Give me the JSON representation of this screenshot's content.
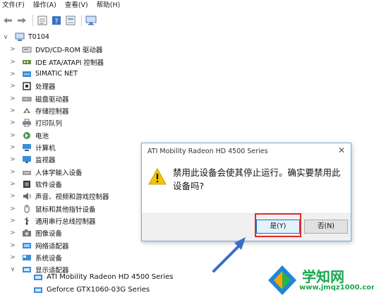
{
  "menu": [
    "文件(F)",
    "操作(A)",
    "查看(V)",
    "帮助(H)"
  ],
  "toolbar_icons": [
    "back-arrow-icon",
    "forward-arrow-icon",
    "properties-icon",
    "help-icon",
    "device-view-icon",
    "monitor-icon"
  ],
  "tree": {
    "root": "T0104",
    "categories": [
      {
        "label": "DVD/CD-ROM 驱动器",
        "icon": "dvd-drive-icon",
        "expanded": false
      },
      {
        "label": "IDE ATA/ATAPI 控制器",
        "icon": "ide-controller-icon",
        "expanded": false
      },
      {
        "label": "SIMATIC NET",
        "icon": "network-icon",
        "expanded": false
      },
      {
        "label": "处理器",
        "icon": "processor-icon",
        "expanded": false
      },
      {
        "label": "磁盘驱动器",
        "icon": "disk-drive-icon",
        "expanded": false
      },
      {
        "label": "存储控制器",
        "icon": "storage-controller-icon",
        "expanded": false
      },
      {
        "label": "打印队列",
        "icon": "printer-icon",
        "expanded": false
      },
      {
        "label": "电池",
        "icon": "battery-icon",
        "expanded": false
      },
      {
        "label": "计算机",
        "icon": "computer-icon",
        "expanded": false
      },
      {
        "label": "监视器",
        "icon": "monitor-icon",
        "expanded": false
      },
      {
        "label": "人体学输入设备",
        "icon": "hid-icon",
        "expanded": false
      },
      {
        "label": "软件设备",
        "icon": "software-device-icon",
        "expanded": false
      },
      {
        "label": "声音、视频和游戏控制器",
        "icon": "sound-icon",
        "expanded": false
      },
      {
        "label": "鼠标和其他指针设备",
        "icon": "mouse-icon",
        "expanded": false
      },
      {
        "label": "通用串行总线控制器",
        "icon": "usb-icon",
        "expanded": false
      },
      {
        "label": "图像设备",
        "icon": "camera-icon",
        "expanded": false
      },
      {
        "label": "网络适配器",
        "icon": "network-adapter-icon",
        "expanded": false
      },
      {
        "label": "系统设备",
        "icon": "system-device-icon",
        "expanded": false
      },
      {
        "label": "显示适配器",
        "icon": "display-adapter-icon",
        "expanded": true
      }
    ],
    "display_children": [
      "ATI Mobility Radeon HD 4500 Series",
      "Geforce GTX1060-03G Series"
    ]
  },
  "dialog": {
    "title": "ATI Mobility Radeon HD 4500 Series",
    "message": "禁用此设备会使其停止运行。确实要禁用此设备吗?",
    "yes_label": "是(Y)",
    "no_label": "否(N)"
  },
  "watermark": {
    "title": "学知网",
    "url": "www.jmqz1000.com"
  },
  "colors": {
    "highlight": "#e22a2a",
    "arrow": "#3b6fc4",
    "watermark": "#1aa84e",
    "dialog_border": "#7ea7d8"
  }
}
